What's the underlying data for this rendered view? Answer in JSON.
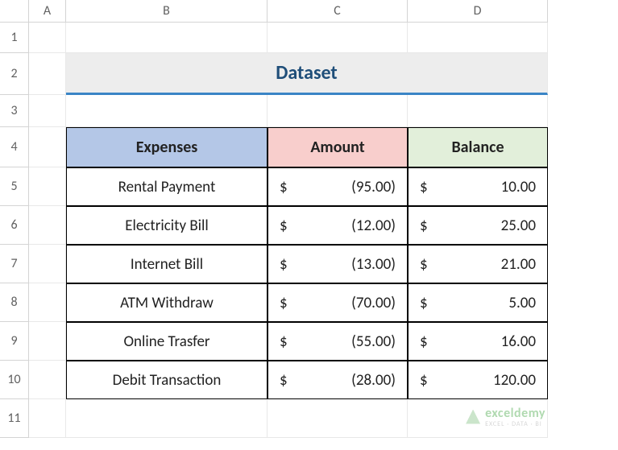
{
  "columns": [
    "A",
    "B",
    "C",
    "D"
  ],
  "rows": [
    "1",
    "2",
    "3",
    "4",
    "5",
    "6",
    "7",
    "8",
    "9",
    "10",
    "11"
  ],
  "title": "Dataset",
  "headers": {
    "expenses": "Expenses",
    "amount": "Amount",
    "balance": "Balance"
  },
  "currencySymbol": "$",
  "chart_data": {
    "type": "table",
    "title": "Dataset",
    "columns": [
      "Expenses",
      "Amount",
      "Balance"
    ],
    "rows": [
      {
        "expense": "Rental Payment",
        "amount": "(95.00)",
        "balance": "10.00"
      },
      {
        "expense": "Electricity Bill",
        "amount": "(12.00)",
        "balance": "25.00"
      },
      {
        "expense": "Internet Bill",
        "amount": "(13.00)",
        "balance": "21.00"
      },
      {
        "expense": "ATM Withdraw",
        "amount": "(70.00)",
        "balance": "5.00"
      },
      {
        "expense": "Online Trasfer",
        "amount": "(55.00)",
        "balance": "16.00"
      },
      {
        "expense": "Debit Transaction",
        "amount": "(28.00)",
        "balance": "120.00"
      }
    ]
  },
  "watermark": {
    "brand": "exceldemy",
    "tagline": "EXCEL · DATA · BI"
  }
}
